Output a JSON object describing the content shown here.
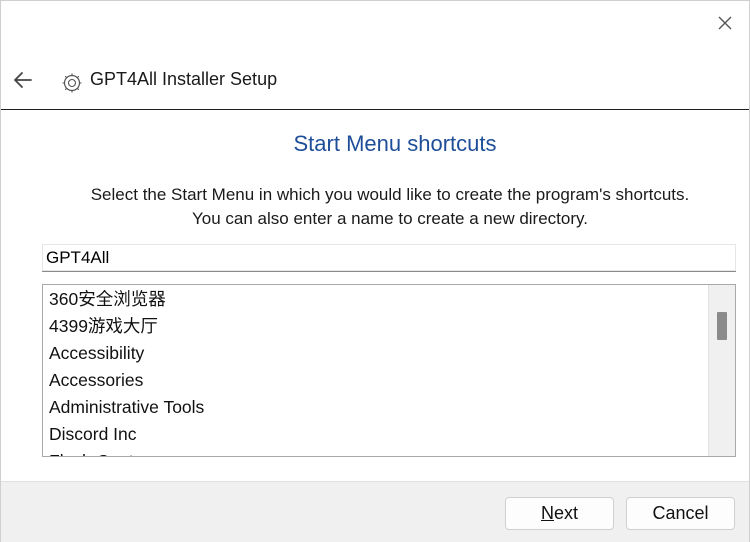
{
  "window": {
    "title": "GPT4All Installer Setup",
    "close_icon": "close-icon",
    "back_icon": "arrow-left-icon",
    "app_icon": "gpt4all-logo-icon"
  },
  "page": {
    "heading": "Start Menu shortcuts",
    "description_line1": "Select the Start Menu in which you would like to create the program's shortcuts.",
    "description_line2": "You can also enter a name to create a new directory."
  },
  "folder_name": {
    "value": "GPT4All"
  },
  "folders": [
    "360安全浏览器",
    "4399游戏大厅",
    "Accessibility",
    "Accessories",
    "Administrative Tools",
    "Discord Inc",
    "Flash Center"
  ],
  "buttons": {
    "next_mnemonic": "N",
    "next_rest": "ext",
    "cancel": "Cancel"
  },
  "colors": {
    "heading": "#1f4e99",
    "footer_bg": "#f0f0f0"
  }
}
